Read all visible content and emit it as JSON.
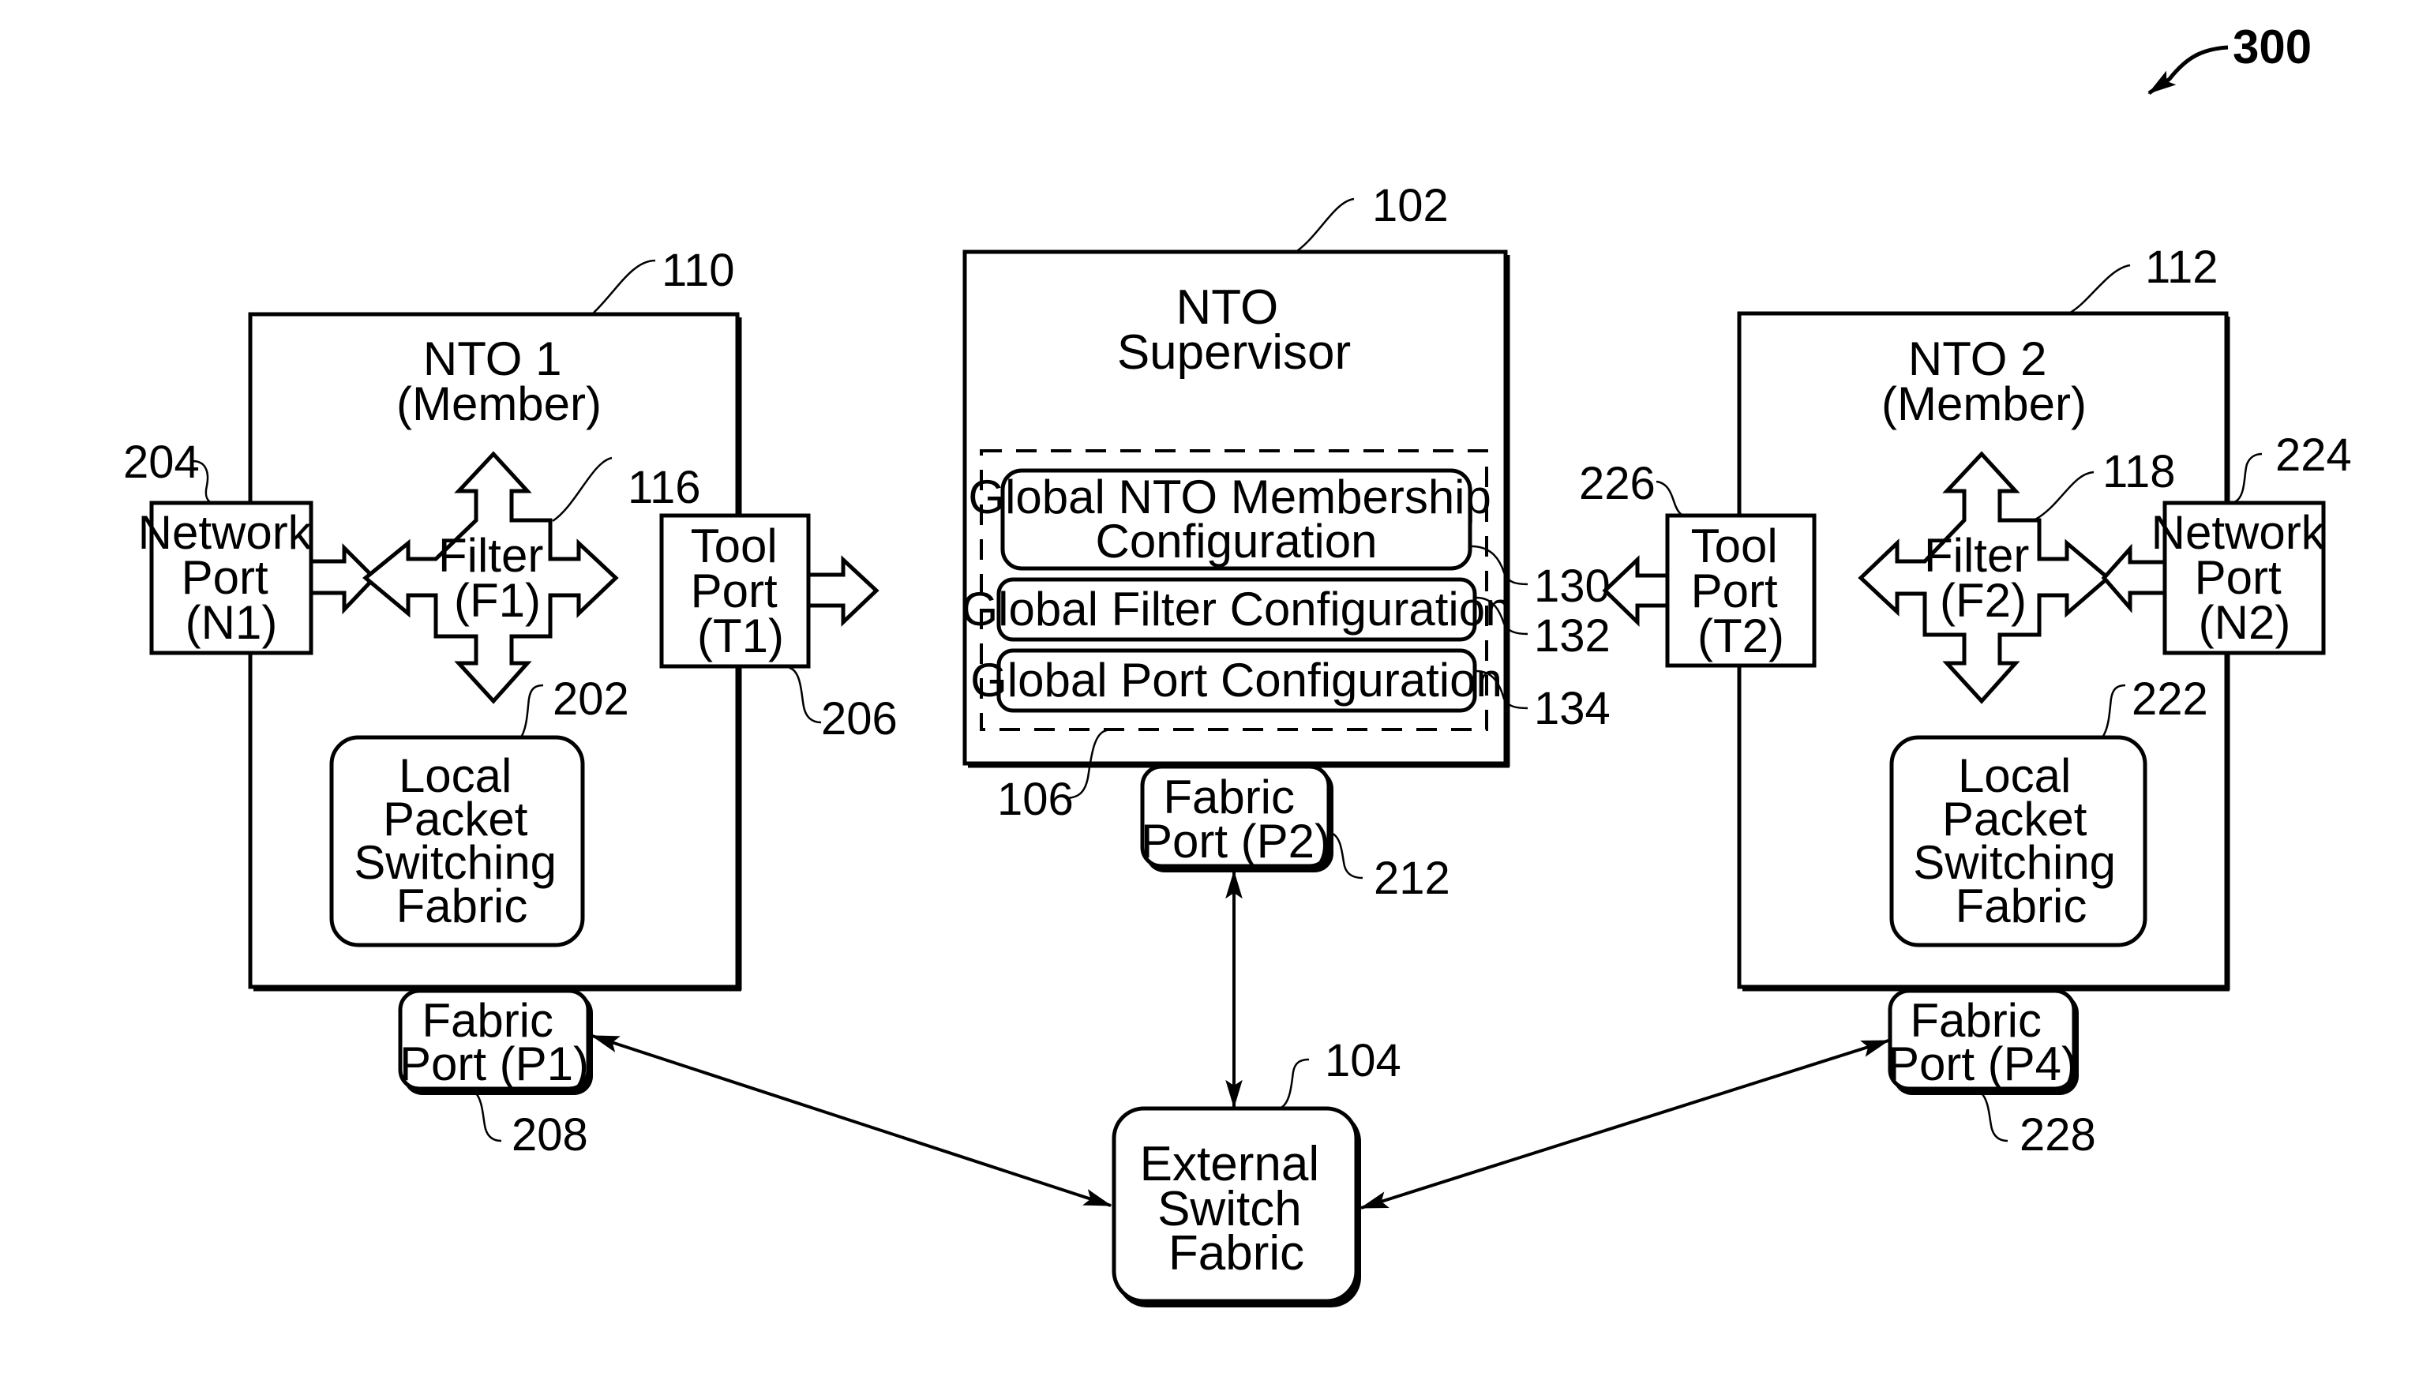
{
  "figure": {
    "ref": "300",
    "colors": {
      "ink": "#000000",
      "paper": "#ffffff"
    }
  },
  "nto1": {
    "ref": "110",
    "title": [
      "NTO 1",
      "(Member)"
    ],
    "network_port": {
      "ref": "204",
      "lines": [
        "Network",
        "Port",
        "(N1)"
      ]
    },
    "filter": {
      "ref": "116",
      "lines": [
        "Filter",
        "(F1)"
      ]
    },
    "tool_port": {
      "ref": "206",
      "lines": [
        "Tool",
        "Port",
        "(T1)"
      ]
    },
    "local_fabric": {
      "ref": "202",
      "lines": [
        "Local",
        "Packet",
        "Switching",
        "Fabric"
      ]
    },
    "fabric_port": {
      "ref": "208",
      "lines": [
        "Fabric",
        "Port (P1)"
      ]
    }
  },
  "supervisor": {
    "ref": "102",
    "title": [
      "NTO",
      "Supervisor"
    ],
    "config_group": {
      "ref": "106"
    },
    "configs": [
      {
        "ref": "130",
        "lines": [
          "Global NTO Membership",
          "Configuration"
        ]
      },
      {
        "ref": "132",
        "lines": [
          "Global Filter Configuration"
        ]
      },
      {
        "ref": "134",
        "lines": [
          "Global Port Configuration"
        ]
      }
    ],
    "fabric_port": {
      "ref": "212",
      "lines": [
        "Fabric",
        "Port (P2)"
      ]
    }
  },
  "nto2": {
    "ref": "112",
    "title": [
      "NTO 2",
      "(Member)"
    ],
    "network_port": {
      "ref": "224",
      "lines": [
        "Network",
        "Port",
        "(N2)"
      ]
    },
    "filter": {
      "ref": "118",
      "lines": [
        "Filter",
        "(F2)"
      ]
    },
    "tool_port": {
      "ref": "226",
      "lines": [
        "Tool",
        "Port",
        "(T2)"
      ]
    },
    "local_fabric": {
      "ref": "222",
      "lines": [
        "Local",
        "Packet",
        "Switching",
        "Fabric"
      ]
    },
    "fabric_port": {
      "ref": "228",
      "lines": [
        "Fabric",
        "Port (P4)"
      ]
    }
  },
  "external_switch": {
    "ref": "104",
    "lines": [
      "External",
      "Switch",
      "Fabric"
    ]
  },
  "connections": [
    {
      "from": "Fabric Port (P1)",
      "to": "External Switch Fabric",
      "type": "bidirectional"
    },
    {
      "from": "Fabric Port (P2)",
      "to": "External Switch Fabric",
      "type": "bidirectional"
    },
    {
      "from": "Fabric Port (P4)",
      "to": "External Switch Fabric",
      "type": "bidirectional"
    }
  ]
}
